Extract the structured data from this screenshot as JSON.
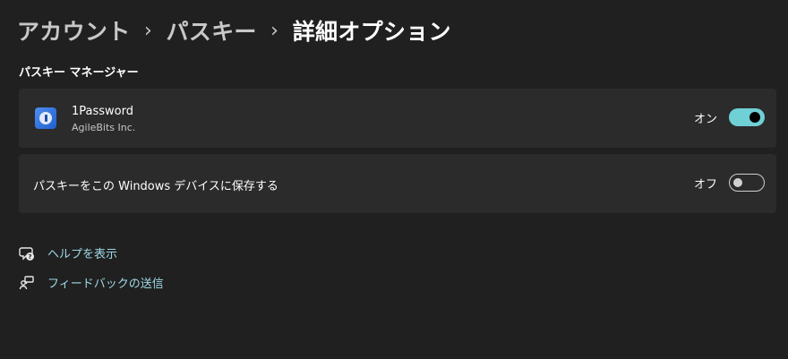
{
  "breadcrumb": {
    "items": [
      "アカウント",
      "パスキー"
    ],
    "separator": "›",
    "current": "詳細オプション"
  },
  "section": {
    "heading": "パスキー マネージャー"
  },
  "passkey_manager": {
    "name": "1Password",
    "publisher": "AgileBits Inc.",
    "icon": "1password-logo-icon",
    "toggle_label": "オン",
    "enabled": true
  },
  "save_to_windows": {
    "label": "パスキーをこの Windows デバイスに保存する",
    "toggle_label": "オフ",
    "enabled": false
  },
  "links": {
    "help": {
      "label": "ヘルプを表示",
      "icon": "help-chat-icon"
    },
    "feedback": {
      "label": "フィードバックの送信",
      "icon": "feedback-icon"
    }
  },
  "colors": {
    "background": "#202020",
    "card": "#2b2b2b",
    "accent": "#6fd0d6",
    "link": "#9fd8e6"
  }
}
